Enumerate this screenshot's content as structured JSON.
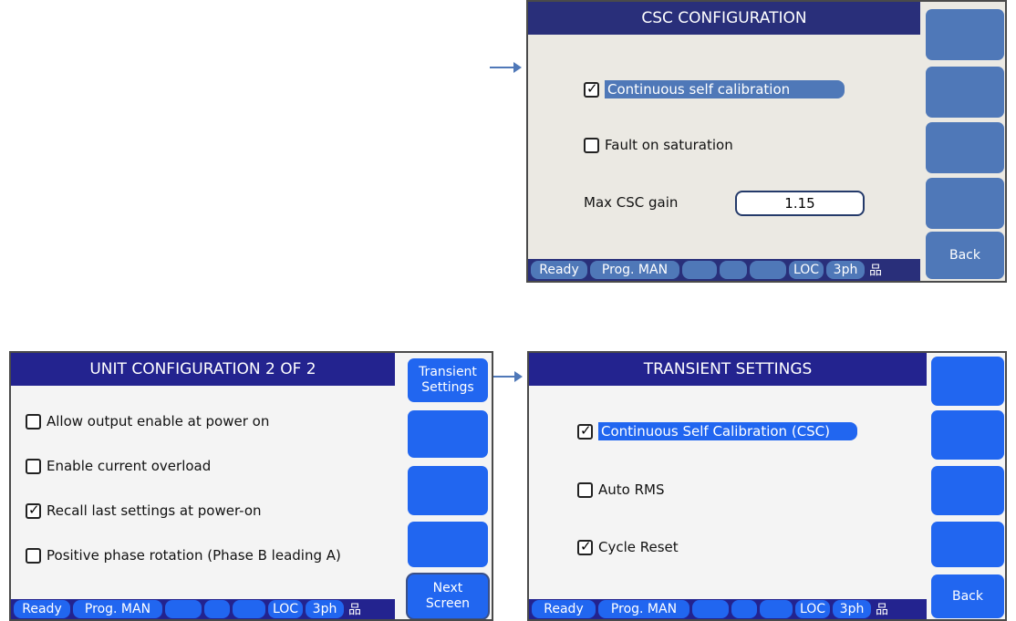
{
  "csc_screen": {
    "title": "CSC CONFIGURATION",
    "options": [
      {
        "label": "Continuous self calibration",
        "checked": true,
        "selected": true
      },
      {
        "label": "Fault on saturation",
        "checked": false,
        "selected": false
      }
    ],
    "max_gain_label": "Max CSC gain",
    "max_gain_value": "1.15",
    "side_buttons": [
      "",
      "",
      "",
      "",
      "Back"
    ],
    "status": {
      "ready": "Ready",
      "prog": "Prog. MAN",
      "loc": "LOC",
      "phase": "3ph"
    }
  },
  "unit_screen": {
    "title": "UNIT CONFIGURATION 2 OF 2",
    "options": [
      {
        "label": "Allow output enable at power on",
        "checked": false
      },
      {
        "label": "Enable current overload",
        "checked": false
      },
      {
        "label": "Recall last settings at power-on",
        "checked": true
      },
      {
        "label": "Positive phase rotation (Phase B leading A)",
        "checked": false
      }
    ],
    "side_buttons": [
      "Transient Settings",
      "",
      "",
      "",
      "Next Screen"
    ],
    "status": {
      "ready": "Ready",
      "prog": "Prog. MAN",
      "loc": "LOC",
      "phase": "3ph"
    }
  },
  "transient_screen": {
    "title": "TRANSIENT SETTINGS",
    "options": [
      {
        "label": "Continuous Self Calibration (CSC)",
        "checked": true,
        "selected": true
      },
      {
        "label": "Auto RMS",
        "checked": false,
        "selected": false
      },
      {
        "label": "Cycle Reset",
        "checked": true,
        "selected": false
      }
    ],
    "side_buttons": [
      "",
      "",
      "",
      "",
      "Back"
    ],
    "status": {
      "ready": "Ready",
      "prog": "Prog. MAN",
      "loc": "LOC",
      "phase": "3ph"
    }
  },
  "colors": {
    "csc_blue": "#4f78b8",
    "screen_blue": "#2166f0",
    "title_navy": "#23238f"
  }
}
